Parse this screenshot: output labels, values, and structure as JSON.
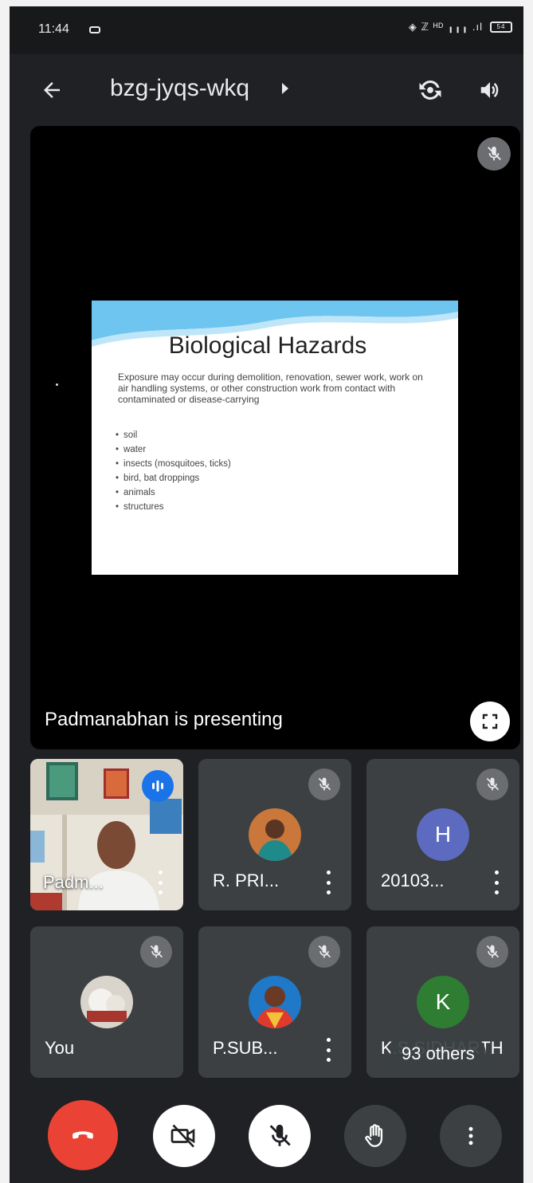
{
  "status_bar": {
    "time": "11:44",
    "indicators": "◈ ℤ ᴴᴰ ╻╻╻ .ıl",
    "battery": "54"
  },
  "header": {
    "meeting_code": "bzg-jyqs-wkq",
    "icons": [
      "back-arrow-icon",
      "camera-switch-icon",
      "speaker-icon"
    ]
  },
  "presentation": {
    "presenter_label": "Padmanabhan is presenting",
    "slide": {
      "title": "Biological Hazards",
      "body": "Exposure may occur during demolition, renovation, sewer work, work on air handling systems, or other construction work from contact with contaminated or disease-carrying",
      "bullets": [
        "soil",
        "water",
        "insects (mosquitoes, ticks)",
        "bird, bat droppings",
        "animals",
        "structures"
      ]
    }
  },
  "participants": [
    {
      "name": "Padm...",
      "type": "video",
      "speaking": true
    },
    {
      "name": "R. PRI...",
      "type": "photo",
      "muted": true
    },
    {
      "name": "20103...",
      "type": "initial",
      "initial": "H",
      "color": "#5c6bc0",
      "muted": true
    },
    {
      "name": "You",
      "type": "photo",
      "muted": true
    },
    {
      "name": "P.SUB...",
      "type": "photo",
      "muted": true
    },
    {
      "name": "K.S.SIDHARTH",
      "type": "initial",
      "initial": "K",
      "color": "#2e7d32",
      "muted": true
    }
  ],
  "others_label": "93 others",
  "controls": [
    "end-call",
    "camera-off",
    "mic-off",
    "raise-hand",
    "more-options"
  ],
  "colors": {
    "end_call": "#ea4335",
    "speaking_badge": "#1a73e8",
    "tile_bg": "#3c4043",
    "background": "#202124"
  }
}
